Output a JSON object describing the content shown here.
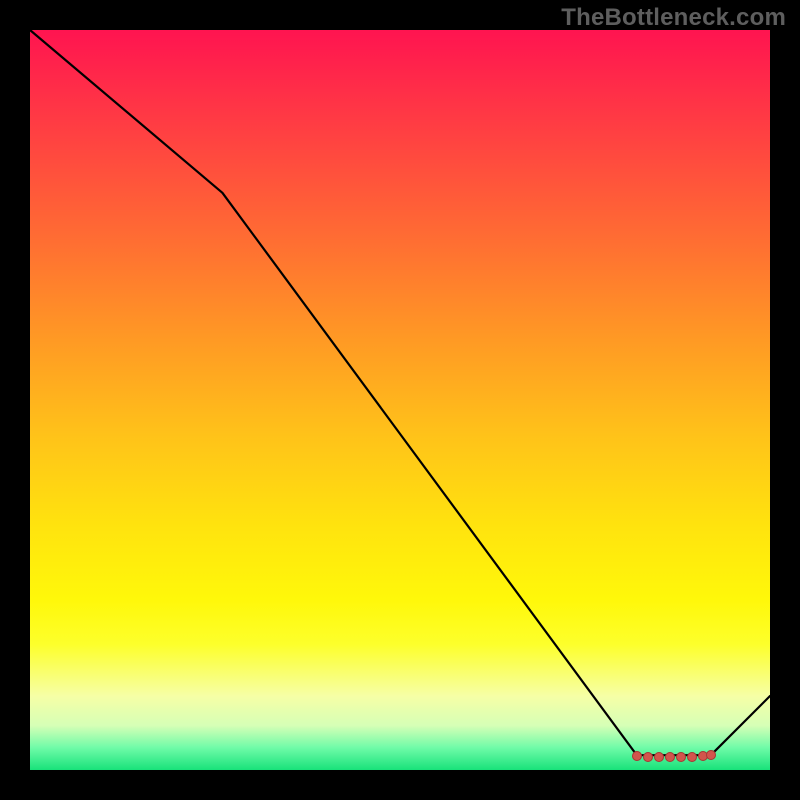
{
  "watermark": "TheBottleneck.com",
  "colors": {
    "background": "#000000",
    "watermark": "#5e5e5e",
    "line": "#000000",
    "marker": "#d2554c"
  },
  "chart_data": {
    "type": "line",
    "title": "",
    "xlabel": "",
    "ylabel": "",
    "xlim": [
      0,
      100
    ],
    "ylim": [
      0,
      100
    ],
    "x": [
      0,
      26,
      82,
      92,
      100
    ],
    "y": [
      100,
      78,
      2,
      2,
      10
    ],
    "marker_points": {
      "x": [
        82,
        83.5,
        85,
        86.5,
        88,
        89.5,
        91,
        92
      ],
      "y": [
        1.9,
        1.8,
        1.7,
        1.7,
        1.7,
        1.8,
        1.9,
        2.0
      ]
    },
    "gradient_stops": [
      {
        "pos": 0,
        "color": "#ff1450"
      },
      {
        "pos": 12,
        "color": "#ff3a44"
      },
      {
        "pos": 28,
        "color": "#ff6c33"
      },
      {
        "pos": 42,
        "color": "#ff9a24"
      },
      {
        "pos": 55,
        "color": "#ffc319"
      },
      {
        "pos": 67,
        "color": "#ffe30e"
      },
      {
        "pos": 77,
        "color": "#fff80a"
      },
      {
        "pos": 83,
        "color": "#fdff2b"
      },
      {
        "pos": 90,
        "color": "#f6ffa6"
      },
      {
        "pos": 94,
        "color": "#d6ffb6"
      },
      {
        "pos": 97,
        "color": "#6ffba8"
      },
      {
        "pos": 100,
        "color": "#18e27a"
      }
    ]
  }
}
